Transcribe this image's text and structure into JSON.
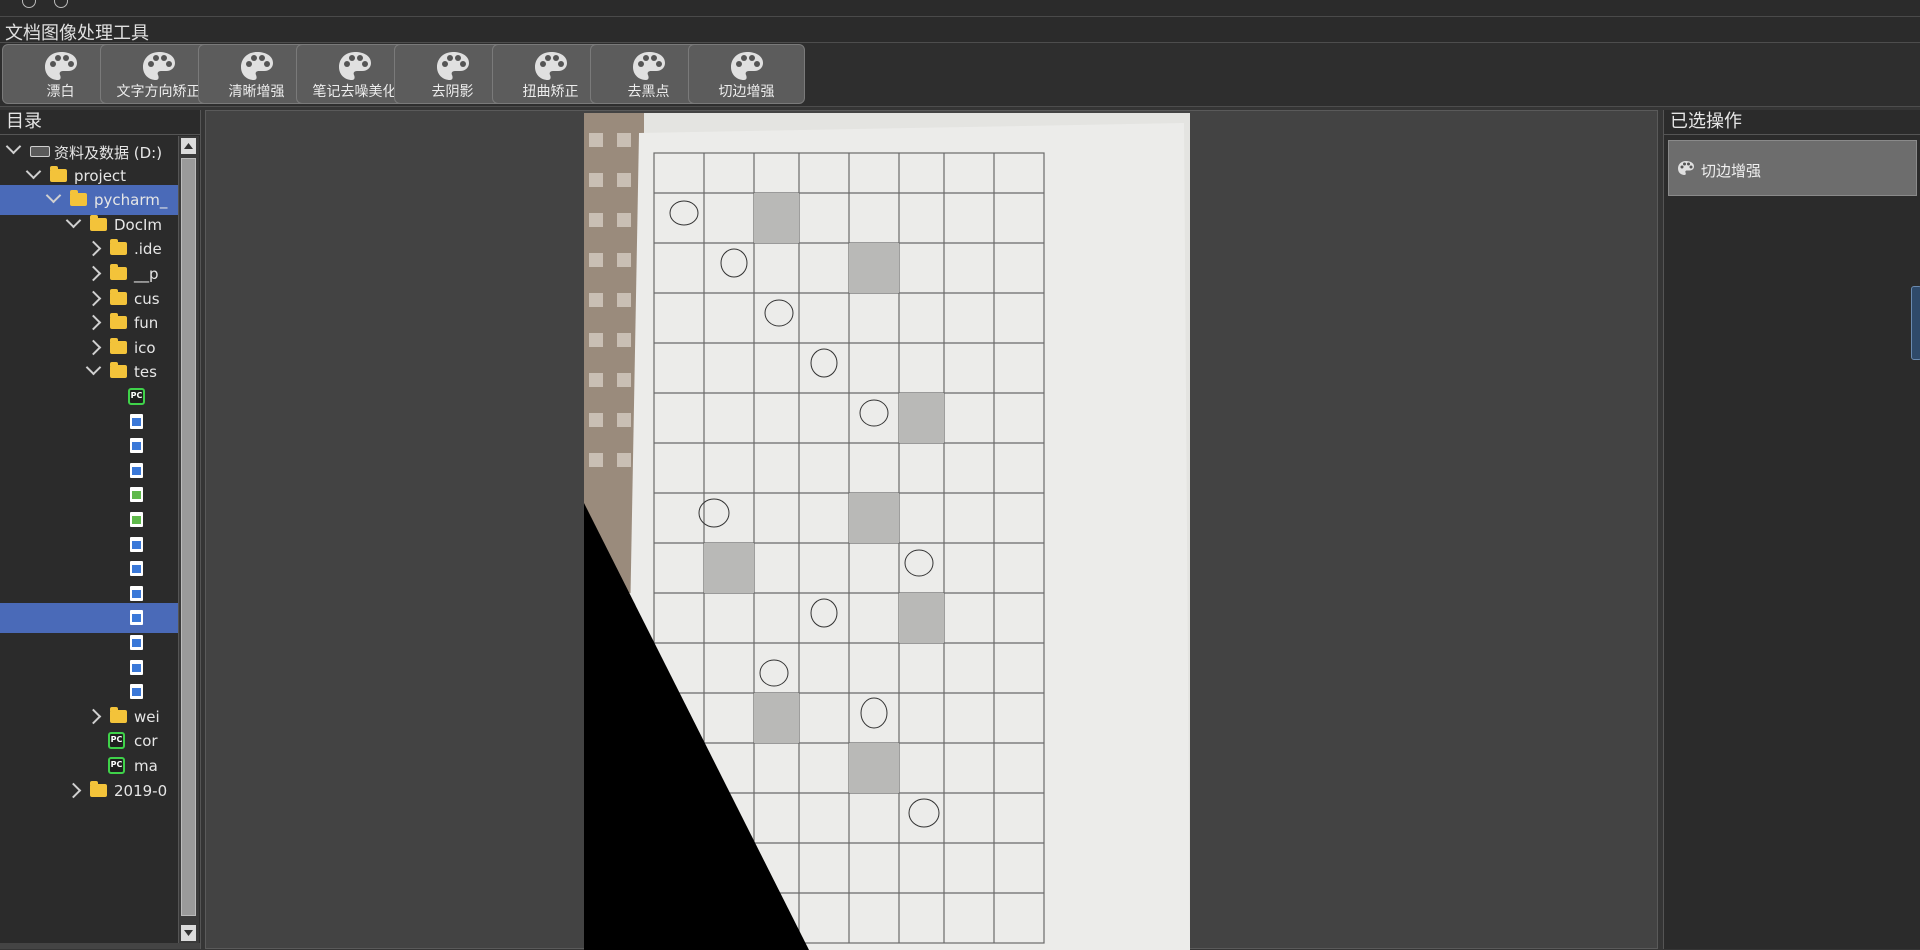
{
  "app": {
    "title": "文档图像处理工具"
  },
  "toolbar": {
    "buttons": [
      {
        "label": "漂白"
      },
      {
        "label": "文字方向矫正"
      },
      {
        "label": "清晰增强"
      },
      {
        "label": "笔记去噪美化"
      },
      {
        "label": "去阴影"
      },
      {
        "label": "扭曲矫正"
      },
      {
        "label": "去黑点"
      },
      {
        "label": "切边增强"
      }
    ]
  },
  "left_panel": {
    "title": "目录",
    "tree": [
      {
        "label": "资料及数据 (D:)",
        "type": "drive",
        "depth": 0,
        "expanded": true
      },
      {
        "label": "project",
        "type": "folder",
        "depth": 1,
        "expanded": true
      },
      {
        "label": "pycharm_",
        "type": "folder",
        "depth": 2,
        "expanded": true,
        "selected": true
      },
      {
        "label": "DocIm",
        "type": "folder",
        "depth": 3,
        "expanded": true
      },
      {
        "label": ".ide",
        "type": "folder",
        "depth": 4,
        "expanded": false
      },
      {
        "label": "__p",
        "type": "folder",
        "depth": 4,
        "expanded": false
      },
      {
        "label": "cus",
        "type": "folder",
        "depth": 4,
        "expanded": false
      },
      {
        "label": "fun",
        "type": "folder",
        "depth": 4,
        "expanded": false
      },
      {
        "label": "ico",
        "type": "folder",
        "depth": 4,
        "expanded": false
      },
      {
        "label": "tes",
        "type": "folder",
        "depth": 4,
        "expanded": true
      },
      {
        "label": "",
        "type": "pycharm-file",
        "depth": 5
      },
      {
        "label": "",
        "type": "file",
        "depth": 5
      },
      {
        "label": "",
        "type": "file",
        "depth": 5
      },
      {
        "label": "",
        "type": "file",
        "depth": 5
      },
      {
        "label": "",
        "type": "file-green",
        "depth": 5
      },
      {
        "label": "",
        "type": "file-green",
        "depth": 5
      },
      {
        "label": "",
        "type": "file",
        "depth": 5
      },
      {
        "label": "",
        "type": "file",
        "depth": 5
      },
      {
        "label": "",
        "type": "file",
        "depth": 5
      },
      {
        "label": "",
        "type": "file",
        "depth": 5,
        "selected": true
      },
      {
        "label": "",
        "type": "file",
        "depth": 5
      },
      {
        "label": "",
        "type": "file",
        "depth": 5
      },
      {
        "label": "",
        "type": "file",
        "depth": 5
      },
      {
        "label": "wei",
        "type": "folder",
        "depth": 4,
        "expanded": false
      },
      {
        "label": "cor",
        "type": "pycharm-file",
        "depth": 4
      },
      {
        "label": "ma",
        "type": "pycharm-file",
        "depth": 4
      },
      {
        "label": "2019-0",
        "type": "folder",
        "depth": 3,
        "expanded": false
      }
    ]
  },
  "right_panel": {
    "title": "已选操作",
    "items": [
      {
        "label": "切边增强",
        "icon": "palette-icon"
      }
    ]
  },
  "colors": {
    "selection": "#4a6ab8",
    "button_bg": "#5c5c5c",
    "folder": "#f3c33a"
  }
}
